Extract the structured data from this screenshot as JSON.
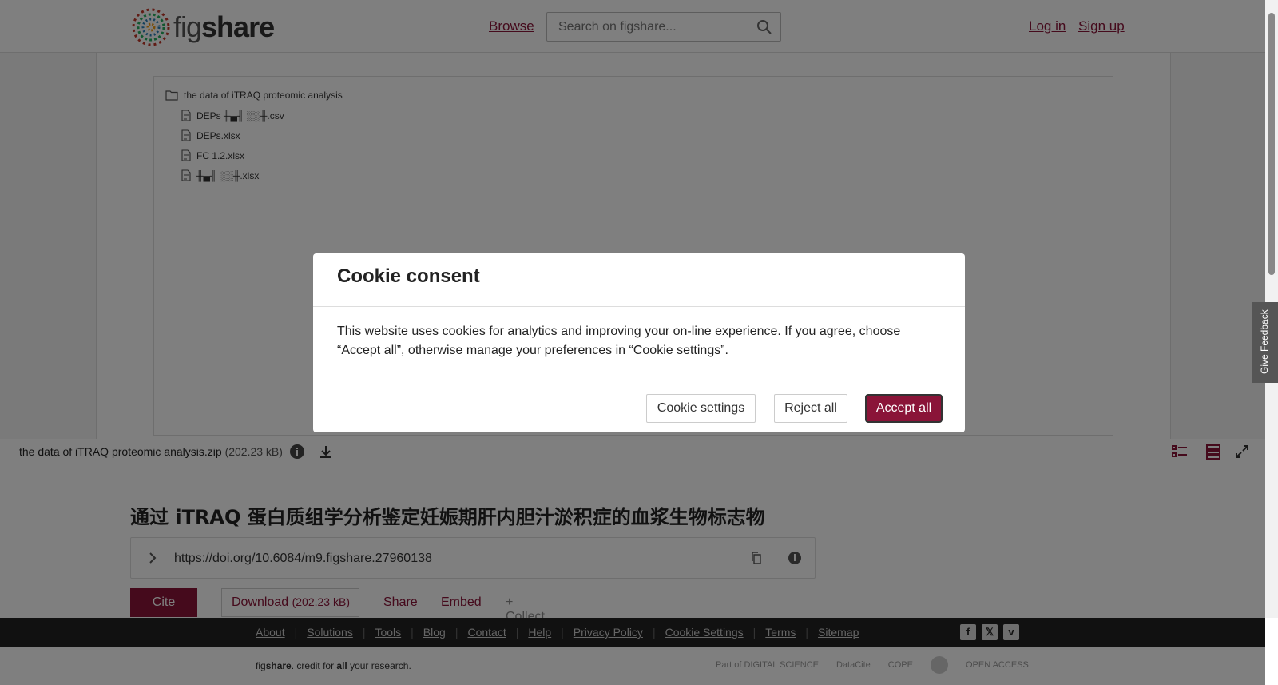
{
  "header": {
    "logo": {
      "prefix": "fig",
      "suffix": "share"
    },
    "browse_label": "Browse",
    "search_placeholder": "Search on figshare...",
    "login_label": "Log in",
    "signup_label": "Sign up"
  },
  "viewer": {
    "root_folder": "the data of iTRAQ proteomic analysis",
    "files": [
      "DEPs ╫▄╢ ░░╫.csv",
      "DEPs.xlsx",
      "FC 1.2.xlsx",
      "╫▄╢ ░░╫.xlsx"
    ],
    "file_name": "the data of iTRAQ proteomic analysis.zip",
    "file_size": "(202.23 kB)"
  },
  "item": {
    "title": "通过 iTRAQ 蛋白质组学分析鉴定妊娠期肝内胆汁淤积症的血浆生物标志物",
    "doi": "https://doi.org/10.6084/m9.figshare.27960138",
    "cite_label": "Cite",
    "download_label": "Download",
    "download_size": "(202.23 kB)",
    "share_label": "Share",
    "embed_label": "Embed",
    "collect_label": "+ Collect"
  },
  "footer": {
    "links": [
      "About",
      "Solutions",
      "Tools",
      "Blog",
      "Contact",
      "Help",
      "Privacy Policy",
      "Cookie Settings",
      "Terms",
      "Sitemap"
    ],
    "tagline_fig": "fig",
    "tagline_share": "share",
    "tagline_mid": ". credit for ",
    "tagline_all": "all",
    "tagline_end": " your research.",
    "partners": [
      "Part of DIGITAL SCIENCE",
      "DataCite",
      "COPE",
      "",
      "OPEN ACCESS"
    ]
  },
  "cookie_modal": {
    "title": "Cookie consent",
    "body": "This website uses cookies for analytics and improving your on-line experience. If you agree, choose “Accept all”, otherwise manage your preferences in “Cookie settings”.",
    "settings_label": "Cookie settings",
    "reject_label": "Reject all",
    "accept_label": "Accept all"
  },
  "feedback_label": "Give Feedback",
  "colors": {
    "brand": "#8a1438",
    "footer": "#222222"
  }
}
